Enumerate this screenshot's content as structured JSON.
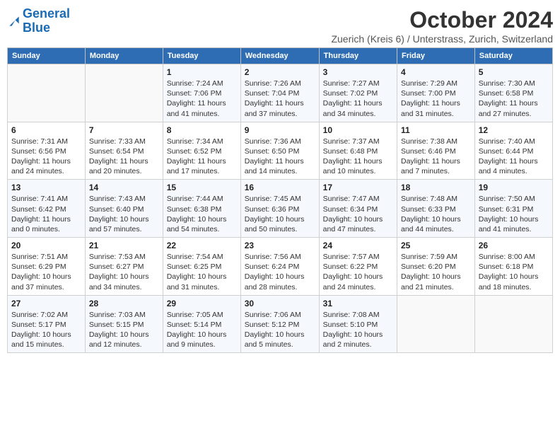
{
  "header": {
    "logo_line1": "General",
    "logo_line2": "Blue",
    "month_title": "October 2024",
    "location": "Zuerich (Kreis 6) / Unterstrass, Zurich, Switzerland"
  },
  "weekdays": [
    "Sunday",
    "Monday",
    "Tuesday",
    "Wednesday",
    "Thursday",
    "Friday",
    "Saturday"
  ],
  "weeks": [
    [
      {
        "day": "",
        "info": ""
      },
      {
        "day": "",
        "info": ""
      },
      {
        "day": "1",
        "info": "Sunrise: 7:24 AM\nSunset: 7:06 PM\nDaylight: 11 hours and 41 minutes."
      },
      {
        "day": "2",
        "info": "Sunrise: 7:26 AM\nSunset: 7:04 PM\nDaylight: 11 hours and 37 minutes."
      },
      {
        "day": "3",
        "info": "Sunrise: 7:27 AM\nSunset: 7:02 PM\nDaylight: 11 hours and 34 minutes."
      },
      {
        "day": "4",
        "info": "Sunrise: 7:29 AM\nSunset: 7:00 PM\nDaylight: 11 hours and 31 minutes."
      },
      {
        "day": "5",
        "info": "Sunrise: 7:30 AM\nSunset: 6:58 PM\nDaylight: 11 hours and 27 minutes."
      }
    ],
    [
      {
        "day": "6",
        "info": "Sunrise: 7:31 AM\nSunset: 6:56 PM\nDaylight: 11 hours and 24 minutes."
      },
      {
        "day": "7",
        "info": "Sunrise: 7:33 AM\nSunset: 6:54 PM\nDaylight: 11 hours and 20 minutes."
      },
      {
        "day": "8",
        "info": "Sunrise: 7:34 AM\nSunset: 6:52 PM\nDaylight: 11 hours and 17 minutes."
      },
      {
        "day": "9",
        "info": "Sunrise: 7:36 AM\nSunset: 6:50 PM\nDaylight: 11 hours and 14 minutes."
      },
      {
        "day": "10",
        "info": "Sunrise: 7:37 AM\nSunset: 6:48 PM\nDaylight: 11 hours and 10 minutes."
      },
      {
        "day": "11",
        "info": "Sunrise: 7:38 AM\nSunset: 6:46 PM\nDaylight: 11 hours and 7 minutes."
      },
      {
        "day": "12",
        "info": "Sunrise: 7:40 AM\nSunset: 6:44 PM\nDaylight: 11 hours and 4 minutes."
      }
    ],
    [
      {
        "day": "13",
        "info": "Sunrise: 7:41 AM\nSunset: 6:42 PM\nDaylight: 11 hours and 0 minutes."
      },
      {
        "day": "14",
        "info": "Sunrise: 7:43 AM\nSunset: 6:40 PM\nDaylight: 10 hours and 57 minutes."
      },
      {
        "day": "15",
        "info": "Sunrise: 7:44 AM\nSunset: 6:38 PM\nDaylight: 10 hours and 54 minutes."
      },
      {
        "day": "16",
        "info": "Sunrise: 7:45 AM\nSunset: 6:36 PM\nDaylight: 10 hours and 50 minutes."
      },
      {
        "day": "17",
        "info": "Sunrise: 7:47 AM\nSunset: 6:34 PM\nDaylight: 10 hours and 47 minutes."
      },
      {
        "day": "18",
        "info": "Sunrise: 7:48 AM\nSunset: 6:33 PM\nDaylight: 10 hours and 44 minutes."
      },
      {
        "day": "19",
        "info": "Sunrise: 7:50 AM\nSunset: 6:31 PM\nDaylight: 10 hours and 41 minutes."
      }
    ],
    [
      {
        "day": "20",
        "info": "Sunrise: 7:51 AM\nSunset: 6:29 PM\nDaylight: 10 hours and 37 minutes."
      },
      {
        "day": "21",
        "info": "Sunrise: 7:53 AM\nSunset: 6:27 PM\nDaylight: 10 hours and 34 minutes."
      },
      {
        "day": "22",
        "info": "Sunrise: 7:54 AM\nSunset: 6:25 PM\nDaylight: 10 hours and 31 minutes."
      },
      {
        "day": "23",
        "info": "Sunrise: 7:56 AM\nSunset: 6:24 PM\nDaylight: 10 hours and 28 minutes."
      },
      {
        "day": "24",
        "info": "Sunrise: 7:57 AM\nSunset: 6:22 PM\nDaylight: 10 hours and 24 minutes."
      },
      {
        "day": "25",
        "info": "Sunrise: 7:59 AM\nSunset: 6:20 PM\nDaylight: 10 hours and 21 minutes."
      },
      {
        "day": "26",
        "info": "Sunrise: 8:00 AM\nSunset: 6:18 PM\nDaylight: 10 hours and 18 minutes."
      }
    ],
    [
      {
        "day": "27",
        "info": "Sunrise: 7:02 AM\nSunset: 5:17 PM\nDaylight: 10 hours and 15 minutes."
      },
      {
        "day": "28",
        "info": "Sunrise: 7:03 AM\nSunset: 5:15 PM\nDaylight: 10 hours and 12 minutes."
      },
      {
        "day": "29",
        "info": "Sunrise: 7:05 AM\nSunset: 5:14 PM\nDaylight: 10 hours and 9 minutes."
      },
      {
        "day": "30",
        "info": "Sunrise: 7:06 AM\nSunset: 5:12 PM\nDaylight: 10 hours and 5 minutes."
      },
      {
        "day": "31",
        "info": "Sunrise: 7:08 AM\nSunset: 5:10 PM\nDaylight: 10 hours and 2 minutes."
      },
      {
        "day": "",
        "info": ""
      },
      {
        "day": "",
        "info": ""
      }
    ]
  ]
}
